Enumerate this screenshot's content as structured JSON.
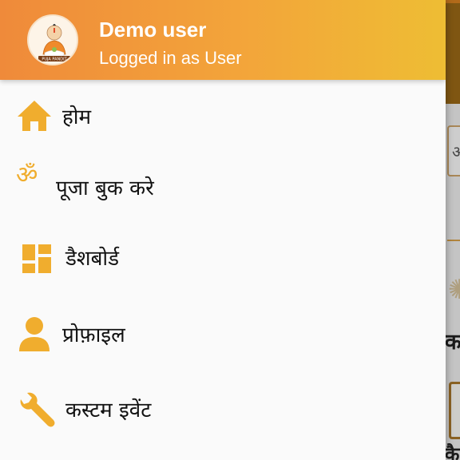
{
  "drawer_header": {
    "user_name": "Demo user",
    "user_status": "Logged in as User",
    "avatar_caption": "PUJA PANDIT"
  },
  "menu": [
    {
      "label": "होम",
      "icon": "home-icon"
    },
    {
      "label": "पूजा बुक करे",
      "icon": "om-icon",
      "icon_glyph": "ॐ"
    },
    {
      "label": "डैशबोर्ड",
      "icon": "dashboard-icon"
    },
    {
      "label": "प्रोफ़ाइल",
      "icon": "profile-icon"
    },
    {
      "label": "कस्टम इवेंट",
      "icon": "wrench-icon"
    }
  ],
  "background": {
    "field_text": "अ",
    "section_text": "क",
    "card_text": "कै"
  },
  "colors": {
    "header_start": "#ef8a3a",
    "header_end": "#eebd34",
    "icon": "#f0ad2e",
    "drawer_bg": "#fafafa"
  }
}
